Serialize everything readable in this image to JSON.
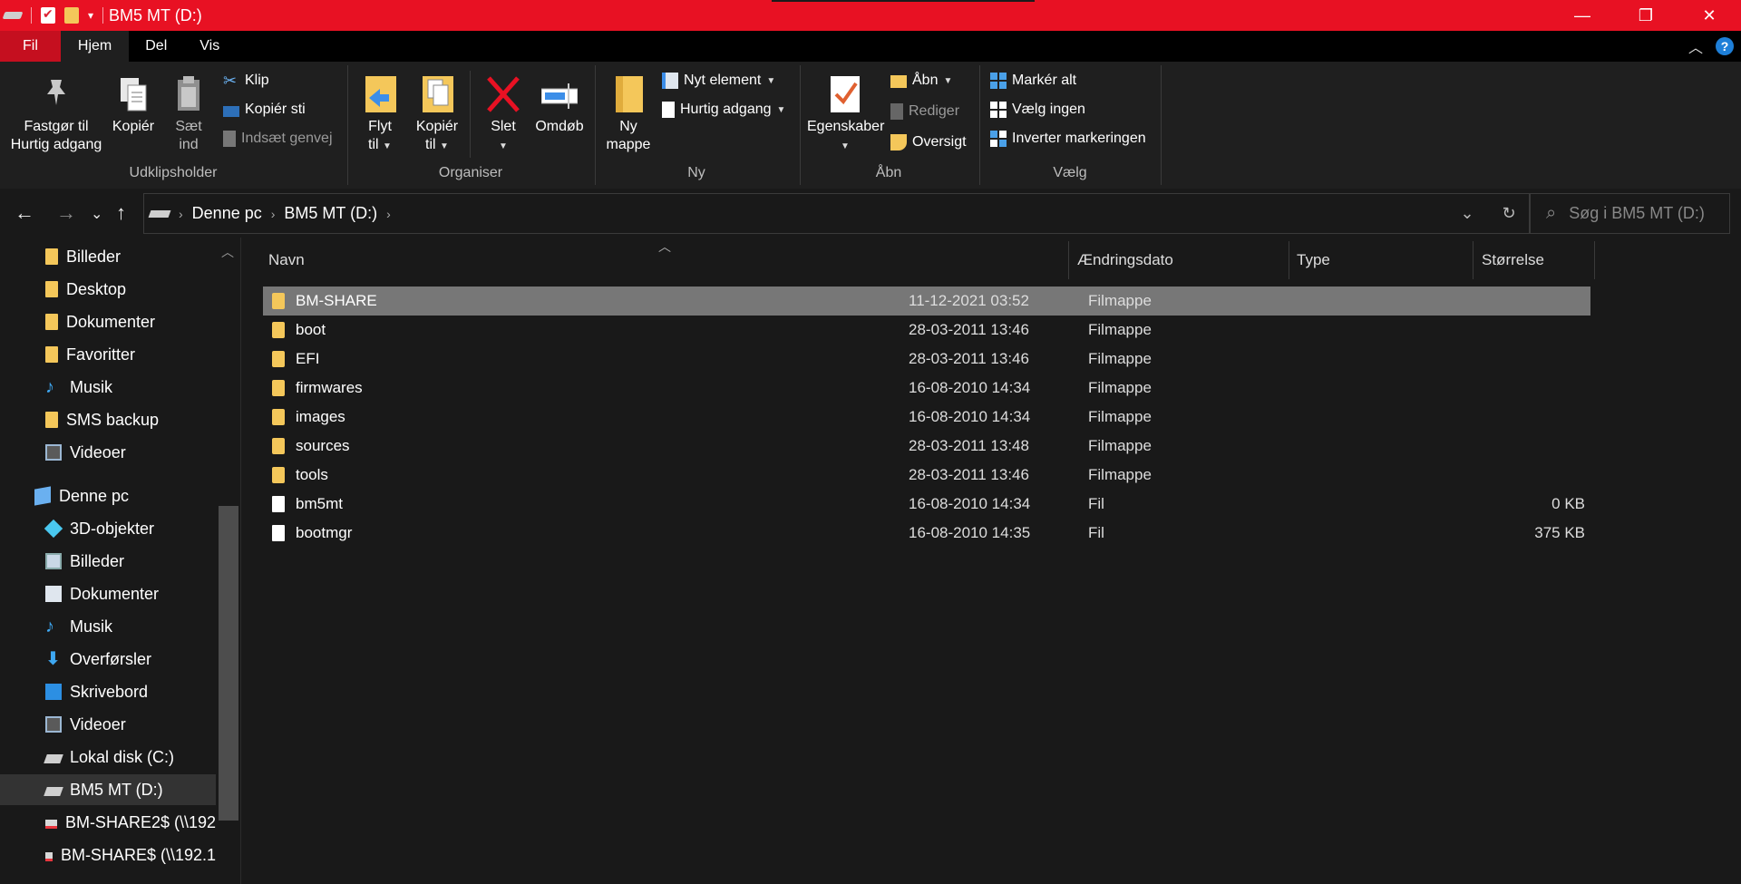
{
  "window": {
    "title": "BM5 MT (D:)"
  },
  "window_controls": {
    "minimize": "—",
    "maximize": "❐",
    "close": "✕"
  },
  "ribbon_tabs": [
    "Fil",
    "Hjem",
    "Del",
    "Vis"
  ],
  "ribbon": {
    "udklipsholder": {
      "label": "Udklipsholder",
      "pin_line1": "Fastgør til",
      "pin_line2": "Hurtig adgang",
      "copy": "Kopiér",
      "paste_line1": "Sæt",
      "paste_line2": "ind",
      "cut": "Klip",
      "copy_path": "Kopiér sti",
      "paste_shortcut": "Indsæt genvej"
    },
    "organiser": {
      "label": "Organiser",
      "move_line1": "Flyt",
      "move_line2": "til",
      "copyto_line1": "Kopiér",
      "copyto_line2": "til",
      "delete": "Slet",
      "rename": "Omdøb"
    },
    "ny": {
      "label": "Ny",
      "new_folder_line1": "Ny",
      "new_folder_line2": "mappe",
      "new_item": "Nyt element",
      "easy_access": "Hurtig adgang"
    },
    "aabn": {
      "label": "Åbn",
      "properties": "Egenskaber",
      "open": "Åbn",
      "edit": "Rediger",
      "history": "Oversigt"
    },
    "vaelg": {
      "label": "Vælg",
      "select_all": "Markér alt",
      "select_none": "Vælg ingen",
      "invert": "Inverter markeringen"
    }
  },
  "address": {
    "crumbs": [
      "Denne pc",
      "BM5 MT (D:)"
    ],
    "search_placeholder": "Søg i BM5 MT (D:)"
  },
  "nav_pane": {
    "items": [
      {
        "label": "Billeder",
        "icon": "folder-icon"
      },
      {
        "label": "Desktop",
        "icon": "folder-icon"
      },
      {
        "label": "Dokumenter",
        "icon": "folder-icon"
      },
      {
        "label": "Favoritter",
        "icon": "folder-icon"
      },
      {
        "label": "Musik",
        "icon": "music-icon"
      },
      {
        "label": "SMS backup",
        "icon": "folder-icon"
      },
      {
        "label": "Videoer",
        "icon": "video-icon"
      },
      {
        "label": "Denne pc",
        "icon": "pc-icon"
      },
      {
        "label": "3D-objekter",
        "icon": "cube-icon"
      },
      {
        "label": "Billeder",
        "icon": "pictures-icon"
      },
      {
        "label": "Dokumenter",
        "icon": "documents-icon"
      },
      {
        "label": "Musik",
        "icon": "music-icon"
      },
      {
        "label": "Overførsler",
        "icon": "download-icon"
      },
      {
        "label": "Skrivebord",
        "icon": "desktop-icon"
      },
      {
        "label": "Videoer",
        "icon": "video-icon"
      },
      {
        "label": "Lokal disk (C:)",
        "icon": "disk-icon"
      },
      {
        "label": "BM5 MT (D:)",
        "icon": "disk-icon"
      },
      {
        "label": "BM-SHARE2$ (\\\\192",
        "icon": "network-drive-icon"
      },
      {
        "label": "BM-SHARE$ (\\\\192.1",
        "icon": "network-drive-icon"
      }
    ]
  },
  "columns": {
    "name": "Navn",
    "date": "Ændringsdato",
    "type": "Type",
    "size": "Størrelse"
  },
  "files": [
    {
      "name": "BM-SHARE",
      "date": "11-12-2021 03:52",
      "type": "Filmappe",
      "size": "",
      "kind": "folder"
    },
    {
      "name": "boot",
      "date": "28-03-2011 13:46",
      "type": "Filmappe",
      "size": "",
      "kind": "folder"
    },
    {
      "name": "EFI",
      "date": "28-03-2011 13:46",
      "type": "Filmappe",
      "size": "",
      "kind": "folder"
    },
    {
      "name": "firmwares",
      "date": "16-08-2010 14:34",
      "type": "Filmappe",
      "size": "",
      "kind": "folder"
    },
    {
      "name": "images",
      "date": "16-08-2010 14:34",
      "type": "Filmappe",
      "size": "",
      "kind": "folder"
    },
    {
      "name": "sources",
      "date": "28-03-2011 13:48",
      "type": "Filmappe",
      "size": "",
      "kind": "folder"
    },
    {
      "name": "tools",
      "date": "28-03-2011 13:46",
      "type": "Filmappe",
      "size": "",
      "kind": "folder"
    },
    {
      "name": "bm5mt",
      "date": "16-08-2010 14:34",
      "type": "Fil",
      "size": "0 KB",
      "kind": "file"
    },
    {
      "name": "bootmgr",
      "date": "16-08-2010 14:35",
      "type": "Fil",
      "size": "375 KB",
      "kind": "file"
    }
  ],
  "colors": {
    "titlebar": "#e81123",
    "file_tab": "#c50f1f",
    "selection": "#777777",
    "folder": "#f4c75a"
  }
}
